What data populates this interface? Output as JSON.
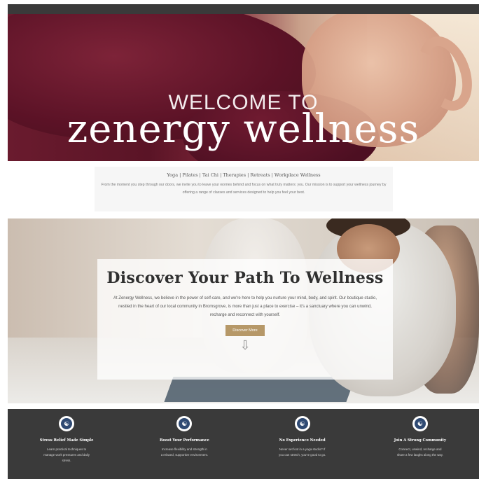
{
  "hero": {
    "subtitle": "WELCOME TO",
    "title": "zenergy wellness"
  },
  "intro": {
    "links": "Yoga | Pilates | Tai Chi | Therapies | Retreats | Workplace Wellness",
    "text": "From the moment you step through our doors, we invite you to leave your worries behind and focus on what truly matters: you. Our mission is to support your wellness journey by offering a range of classes and services designed to help you feel your best."
  },
  "discover": {
    "heading": "Discover Your Path To Wellness",
    "body": "At Zenergy Wellness, we believe in the power of self-care, and we're here to help you nurture your mind, body, and spirit. Our boutique studio, nestled in the heart of our local community in Bromsgrove, is more than just a place to exercise – it's a sanctuary where you can unwind, recharge and reconnect with yourself.",
    "button": "Discover More",
    "arrow": "⇩"
  },
  "features": [
    {
      "icon": "meditation-icon",
      "glyph": "☯",
      "title": "Stress Relief Made Simple",
      "text": "Learn practical techniques to manage work pressures and daily stress."
    },
    {
      "icon": "meditation-icon",
      "glyph": "☯",
      "title": "Boost Your Performance",
      "text": "Increase flexibility and strength in a relaxed, supportive environment."
    },
    {
      "icon": "meditation-icon",
      "glyph": "☯",
      "title": "No Experience Needed",
      "text": "Never set foot in a yoga studio? If you can stretch, you're good to go."
    },
    {
      "icon": "meditation-icon",
      "glyph": "☯",
      "title": "Join A Strong Community",
      "text": "Connect, unwind, recharge and share a few laughs along the way."
    }
  ],
  "colors": {
    "accent": "#b69868",
    "dark": "#3a3a3a",
    "icon_bg": "#2f4a73"
  }
}
